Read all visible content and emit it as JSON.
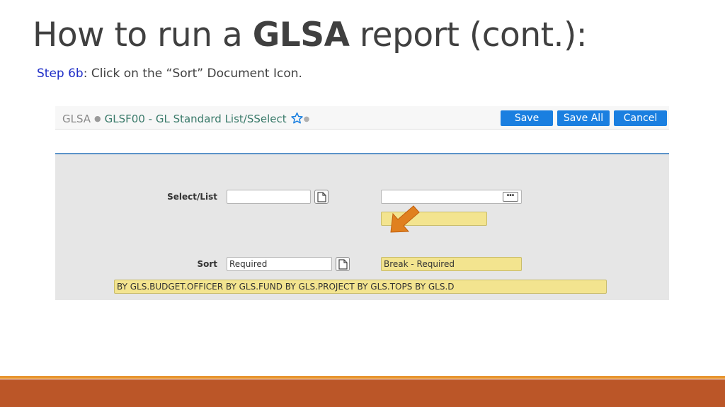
{
  "slide": {
    "title_prefix": "How to run a ",
    "title_bold": "GLSA",
    "title_suffix": " report (cont.):",
    "step_label": "Step 6b",
    "step_text": ": Click on the “Sort” Document Icon."
  },
  "screenshot": {
    "header": {
      "mnemonic": "GLSA",
      "form_name": "GLSF00 - GL Standard List/SSelect",
      "buttons": {
        "save": "Save",
        "save_all": "Save All",
        "cancel": "Cancel"
      }
    },
    "form": {
      "select_list_label": "Select/List",
      "select_list_value": "",
      "select_list_right_value": "",
      "sort_label": "Sort",
      "sort_value": "Required",
      "break_value": "Break - Required",
      "sort_expression": "BY GLS.BUDGET.OFFICER BY GLS.FUND BY GLS.PROJECT BY GLS.TOPS BY GLS.D"
    }
  },
  "colors": {
    "title": "#404040",
    "step_label": "#1f2ec8",
    "button_blue": "#1a7fe0",
    "field_yellow": "#f3e48f",
    "arrow_orange": "#e0801f",
    "footer_orange": "#bb5628"
  },
  "icons": {
    "favorite": "star-outline-icon",
    "document": "document-icon",
    "lookup": "ellipsis-icon",
    "pointer": "arrow-icon"
  }
}
